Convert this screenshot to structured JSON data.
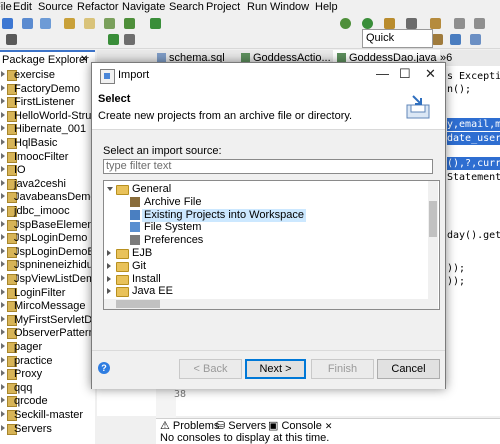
{
  "menu": [
    "File",
    "Edit",
    "Source",
    "Refactor",
    "Navigate",
    "Search",
    "Project",
    "Run",
    "Window",
    "Help"
  ],
  "toolbar": {
    "quick_access": "Quick Access"
  },
  "package_explorer": {
    "title": "Package Explorer",
    "projects": [
      "exercise",
      "FactoryDemo",
      "FirstListener",
      "HelloWorld-Struts",
      "Hibernate_001",
      "HqlBasic",
      "ImoocFilter",
      "IO",
      "java2ceshi",
      "JavabeansDemo1",
      "jdbc_imooc",
      "JspBaseElementDe",
      "JspLoginDemo",
      "JspLoginDemoByM",
      "Jspnineneizhiduixia",
      "JspViewListDemo",
      "LoginFilter",
      "MircoMessage",
      "MyFirstServletDem",
      "ObserverPatternCo",
      "pager",
      "practice",
      "Proxy",
      "qqq",
      "qrcode",
      "Seckill-master",
      "Servers"
    ]
  },
  "editor": {
    "tabs": [
      "schema.sql",
      "GoddessActio...",
      "GoddessDao.java",
      "»6"
    ],
    "code_lines": [
      {
        "text": "s Excepti",
        "selected": false,
        "keyword": "s"
      },
      {
        "text": "n();",
        "selected": false
      },
      {
        "text": "y,email,m",
        "selected": true
      },
      {
        "text": "date_user",
        "selected": true
      },
      {
        "text": "(),?,curr",
        "selected": true
      },
      {
        "text": "Statement",
        "selected": false
      },
      {
        "text": "day().get",
        "selected": false
      },
      {
        "text": "));",
        "selected": false
      },
      {
        "text": "));",
        "selected": false
      }
    ],
    "line_number": "38"
  },
  "bottom_panel": {
    "tabs": [
      "Problems",
      "Servers",
      "Console"
    ],
    "console_text": "No consoles to display at this time."
  },
  "dialog": {
    "title": "Import",
    "heading": "Select",
    "subtitle": "Create new projects from an archive file or directory.",
    "filter_label": "Select an import source:",
    "filter_placeholder": "type filter text",
    "tree": [
      {
        "label": "General",
        "expanded": true,
        "level": 0,
        "icon": "folder-icon"
      },
      {
        "label": "Archive File",
        "level": 1,
        "icon": "archive-icon"
      },
      {
        "label": "Existing Projects into Workspace",
        "level": 1,
        "icon": "projects-icon",
        "selected": true
      },
      {
        "label": "File System",
        "level": 1,
        "icon": "filesystem-icon"
      },
      {
        "label": "Preferences",
        "level": 1,
        "icon": "preferences-icon"
      },
      {
        "label": "EJB",
        "expanded": false,
        "level": 0,
        "icon": "folder-icon"
      },
      {
        "label": "Git",
        "expanded": false,
        "level": 0,
        "icon": "folder-icon"
      },
      {
        "label": "Install",
        "expanded": false,
        "level": 0,
        "icon": "folder-icon"
      },
      {
        "label": "Java EE",
        "expanded": false,
        "level": 0,
        "icon": "folder-icon"
      }
    ],
    "buttons": {
      "help": "?",
      "back": "< Back",
      "next": "Next >",
      "finish": "Finish",
      "cancel": "Cancel"
    }
  }
}
